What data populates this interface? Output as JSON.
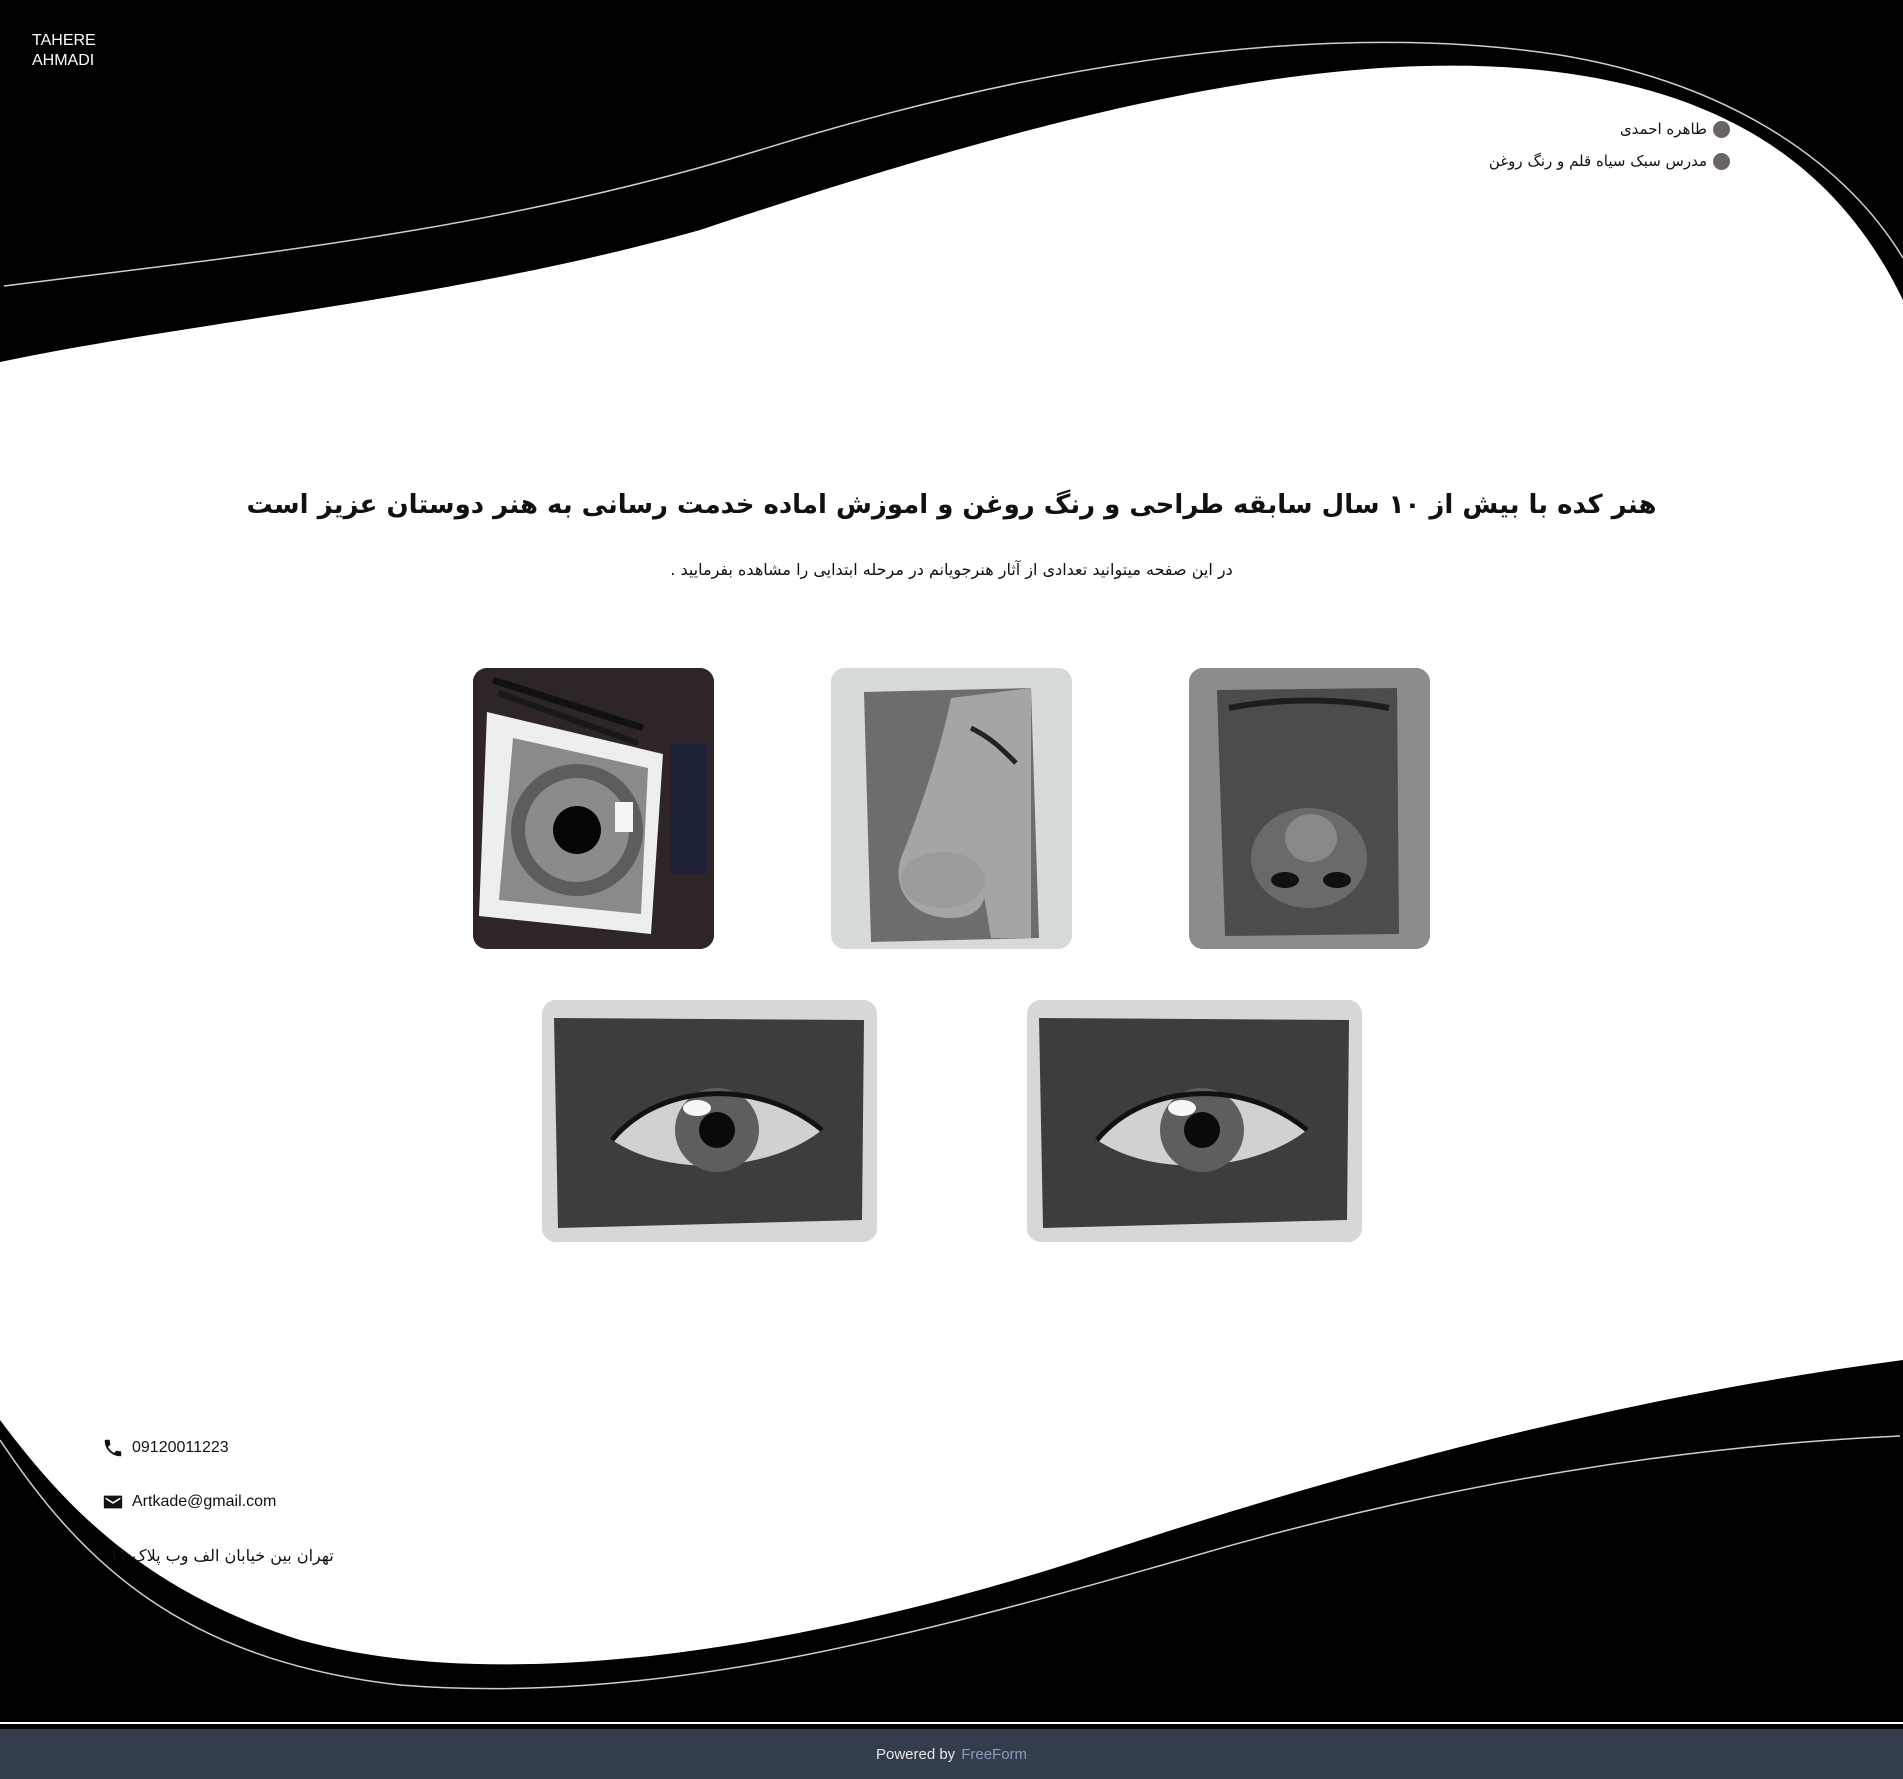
{
  "brand": {
    "line1": "TAHERE",
    "line2": "AHMADI"
  },
  "top_info": {
    "name": "طاهره احمدی",
    "role": "مدرس سبک سیاه قلم و رنگ روغن"
  },
  "main": {
    "headline": "هنر کده با بیش از ۱۰ سال سابقه طراحی و رنگ روغن و اموزش اماده خدمت رسانی به هنر دوستان عزیز است",
    "subline": "در این صفحه میتوانید تعدادی از آثار هنرجویانم در مرحله ابتدایی را مشاهده بفرمایید ."
  },
  "gallery": [
    {
      "icon": "eye-iris-drawing-image"
    },
    {
      "icon": "nose-profile-drawing-image"
    },
    {
      "icon": "nose-front-drawing-image"
    },
    {
      "icon": "eye-closeup-drawing-image"
    },
    {
      "icon": "eye-closeup-drawing-image"
    }
  ],
  "contact": {
    "phone": "09120011223",
    "phone_icon": "phone-icon",
    "email": "Artkade@gmail.com",
    "email_icon": "mail-icon",
    "address": "تهران بین خیابان الف وب پلاک ۱۱"
  },
  "footer": {
    "powered": "Powered by",
    "brand": "FreeForm"
  },
  "colors": {
    "dark": "#000000",
    "footer": "#343d4b",
    "footer_link": "#8c9bb8"
  }
}
